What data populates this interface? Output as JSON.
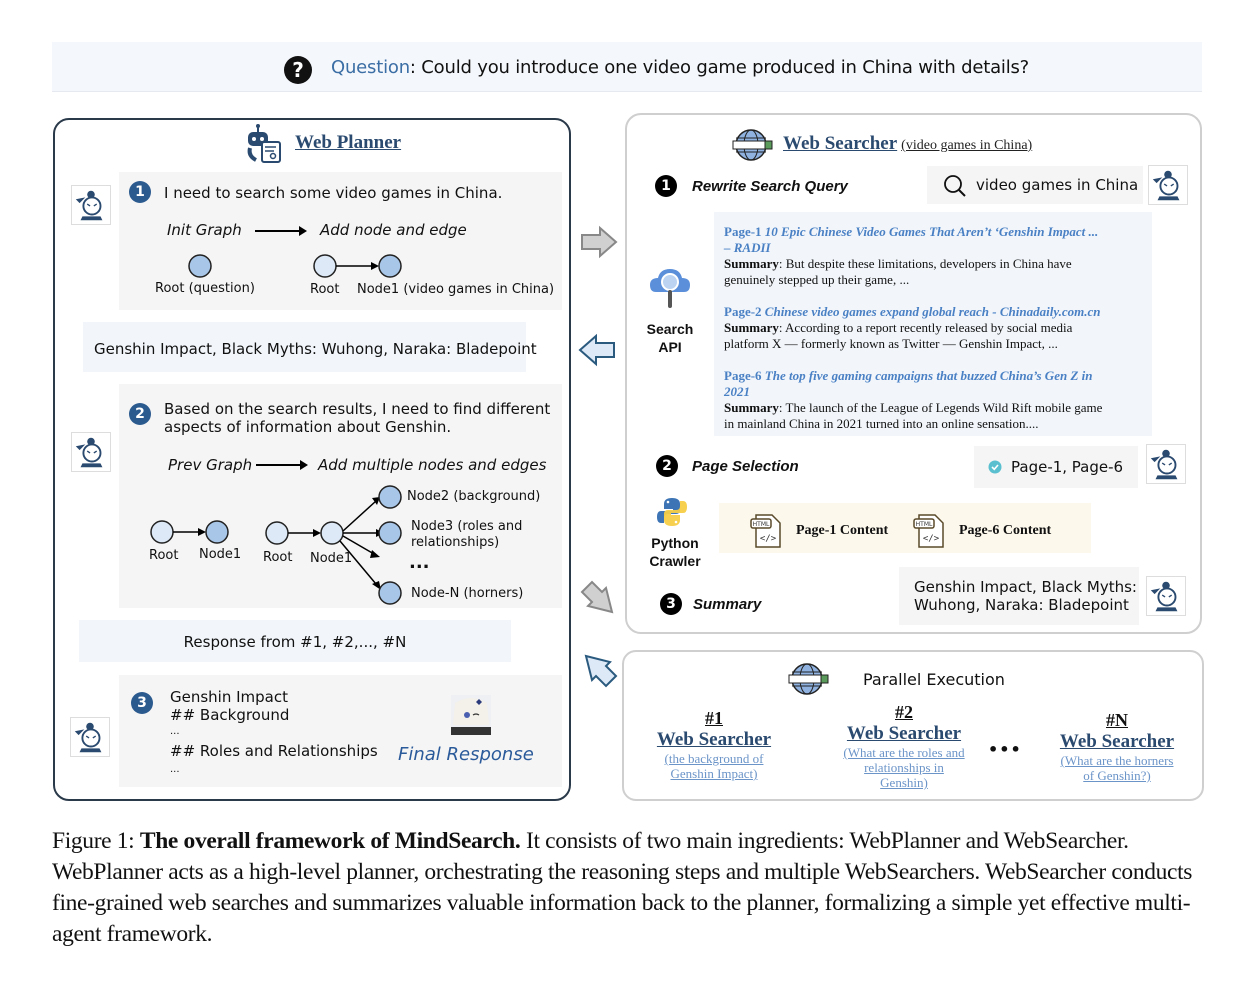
{
  "question": {
    "label": "Question",
    "text": ": Could you introduce one video game produced in China with details?",
    "icon": "question-circle-icon"
  },
  "planner": {
    "title": "Web Planner",
    "step1": {
      "number": "1",
      "text": "I need to search some video games in China.",
      "from_label": "Init Graph",
      "to_label": "Add node and edge",
      "graph_a_label": "Root (question)",
      "graph_b_root": "Root",
      "graph_b_node": "Node1 (video games in China)"
    },
    "result1": "Genshin Impact, Black Myths: Wuhong, Naraka: Bladepoint",
    "step2": {
      "number": "2",
      "text_line1": "Based on the search results, I need to find different",
      "text_line2": "aspects of information about Genshin.",
      "from_label": "Prev Graph",
      "to_label": "Add multiple nodes and edges",
      "prev_root": "Root",
      "prev_node1": "Node1",
      "new_root": "Root",
      "new_node1": "Node1",
      "node2": "Node2 (background)",
      "node3_line1": "Node3 (roles and",
      "node3_line2": "relationships)",
      "ellipsis": "...",
      "nodeN": "Node-N (horners)"
    },
    "response": "Response from #1, #2,..., #N",
    "step3": {
      "number": "3",
      "lines": [
        "Genshin Impact",
        "## Background",
        "...",
        "## Roles and Relationships",
        "..."
      ],
      "final_label": "Final Response"
    }
  },
  "searcher": {
    "title": "Web Searcher",
    "subtitle": "(video games in China)",
    "step1": {
      "number": "1",
      "label": "Rewrite Search Query",
      "query": "video games in China"
    },
    "search_api_label_1": "Search",
    "search_api_label_2": "API",
    "results": [
      {
        "page": "Page-1",
        "title_line1": "10 Epic Chinese Video Games That Aren’t ‘Genshin Impact ...",
        "title_line2": "– RADII",
        "summary_label": "Summary",
        "summary_line1": ": But despite these limitations, developers in China have",
        "summary_line2": "genuinely stepped up their game, ..."
      },
      {
        "page": "Page-2",
        "title_line1": "Chinese video games expand global reach - Chinadaily.com.cn",
        "title_line2": "",
        "summary_label": "Summary",
        "summary_line1": ": According to a report recently released by social media",
        "summary_line2": "platform X — formerly known as Twitter — Genshin Impact, ..."
      },
      {
        "page": "Page-6",
        "title_line1": "The top five gaming campaigns that buzzed China’s Gen Z in",
        "title_line2": "2021",
        "summary_label": "Summary",
        "summary_line1": ": The launch of the League of Legends Wild Rift mobile game",
        "summary_line2": "in mainland China in 2021 turned into an online sensation...."
      }
    ],
    "step2": {
      "number": "2",
      "label": "Page Selection",
      "selected": "Page-1, Page-6"
    },
    "crawler_label_1": "Python",
    "crawler_label_2": "Crawler",
    "crawled": [
      "Page-1 Content",
      "Page-6 Content"
    ],
    "step3": {
      "number": "3",
      "label": "Summary",
      "summary_line1": "Genshin Impact, Black Myths:",
      "summary_line2": "Wuhong, Naraka: Bladepoint"
    }
  },
  "parallel": {
    "title": "Parallel Execution",
    "searchers": [
      {
        "num": "#1",
        "name": "Web Searcher",
        "sub_lines": [
          "(the background of",
          "Genshin Impact)"
        ]
      },
      {
        "num": "#2",
        "name": "Web Searcher",
        "sub_lines": [
          "(What are the roles and",
          "relationships in",
          "Genshin)"
        ]
      },
      {
        "num": "#N",
        "name": "Web Searcher",
        "sub_lines": [
          "(What are the horners",
          "of Genshin?)"
        ]
      }
    ],
    "ellipsis": "•••"
  },
  "caption": {
    "prefix": "Figure 1: ",
    "bold": "The overall framework of MindSearch.",
    "rest": " It consists of two main ingredients: WebPlanner and WebSearcher. WebPlanner acts as a high-level planner, orchestrating the reasoning steps and multiple WebSearchers. WebSearcher conducts fine-grained web searches and summarizes valuable information back to the planner, formalizing a simple yet effective multi-agent framework."
  },
  "colors": {
    "accent_blue": "#2b4a6f",
    "link_blue": "#4a80c4",
    "node_fill_dark": "#a8c6e8",
    "node_fill_light": "#dde9f6"
  }
}
